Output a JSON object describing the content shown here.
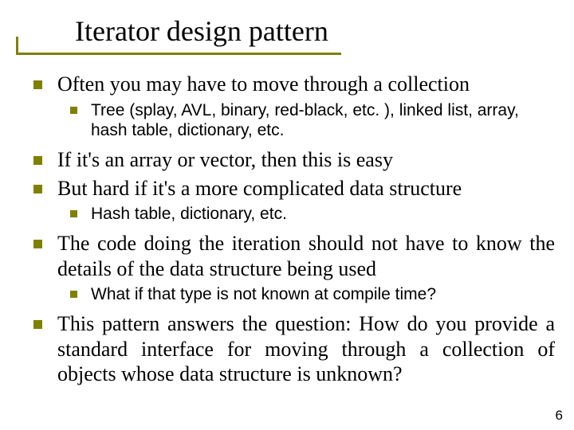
{
  "title": "Iterator design pattern",
  "bullets": {
    "b1": "Often you may have to move through a collection",
    "b1a": "Tree (splay, AVL, binary, red-black, etc. ), linked list, array, hash table, dictionary, etc.",
    "b2": "If it's an array or vector, then this is easy",
    "b3": "But hard if it's a more complicated data structure",
    "b3a": "Hash table, dictionary, etc.",
    "b4": "The code doing the iteration should not have to know the details of the data structure being used",
    "b4a": "What if that type is not known at compile time?",
    "b5": "This pattern answers the question: How do you provide a standard interface for moving through a collection of objects whose data structure is unknown?"
  },
  "page_number": "6"
}
